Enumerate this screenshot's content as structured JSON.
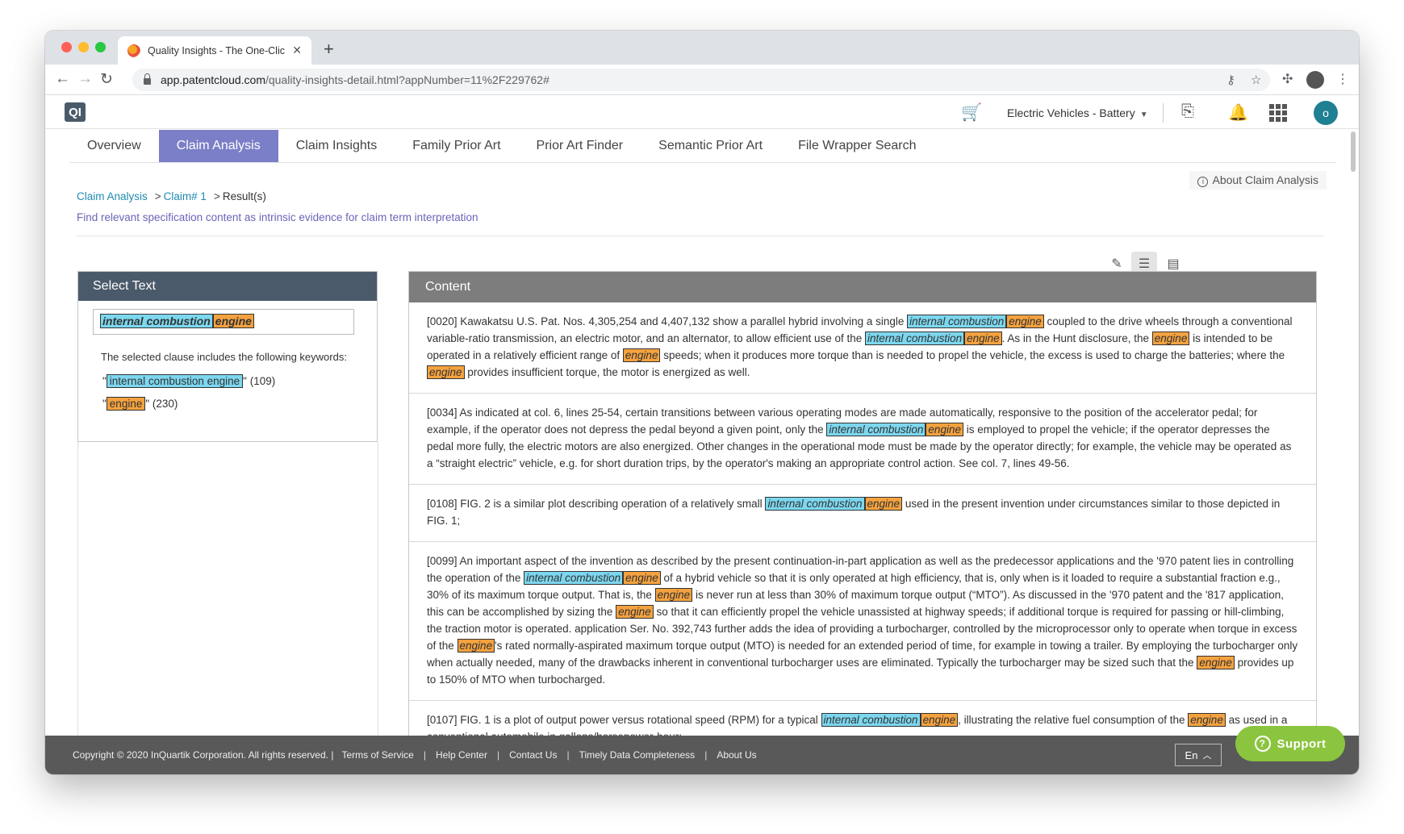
{
  "browser": {
    "tab_title": "Quality Insights - The One-Clic",
    "url_host": "app.patentcloud.com",
    "url_path": "/quality-insights-detail.html?appNumber=11%2F229762#"
  },
  "header": {
    "logo": "QI",
    "project": "Electric Vehicles - Battery",
    "avatar_initial": "o"
  },
  "nav_tabs": [
    {
      "label": "Overview"
    },
    {
      "label": "Claim Analysis"
    },
    {
      "label": "Claim Insights"
    },
    {
      "label": "Family Prior Art"
    },
    {
      "label": "Prior Art Finder"
    },
    {
      "label": "Semantic Prior Art"
    },
    {
      "label": "File Wrapper Search"
    }
  ],
  "about_link": "About Claim Analysis",
  "breadcrumb": {
    "root": "Claim Analysis",
    "claim": "Claim# 1",
    "current": "Result(s)"
  },
  "subtitle": "Find relevant specification content as intrinsic evidence for claim term interpretation",
  "select_panel": {
    "title": "Select Text",
    "selected_part1": "internal combustion",
    "selected_part2": "engine",
    "note": "The selected clause includes the following keywords:",
    "keywords": [
      {
        "term": "internal combustion engine",
        "count": "(109)"
      },
      {
        "term": "engine",
        "count": "(230)"
      }
    ]
  },
  "content_panel": {
    "title": "Content",
    "term_icb": "internal combustion",
    "term_engine": "engine"
  },
  "footer": {
    "copyright": "Copyright © 2020 InQuartik Corporation. All rights reserved. |",
    "links": [
      "Terms of Service",
      "Help Center",
      "Contact Us",
      "Timely Data Completeness",
      "About Us"
    ],
    "language": "En",
    "support": "Support"
  },
  "colors": {
    "accent_tab": "#7b7fc7",
    "highlight_icb": "#7cd7ef",
    "highlight_engine": "#f4a23f",
    "support_green": "#8bc43f"
  },
  "icons": [
    "cart-icon",
    "export-icon",
    "bell-icon",
    "apps-grid-icon",
    "pencil-icon",
    "numbered-list-icon",
    "detail-list-icon",
    "info-icon",
    "chevron-up-icon"
  ]
}
